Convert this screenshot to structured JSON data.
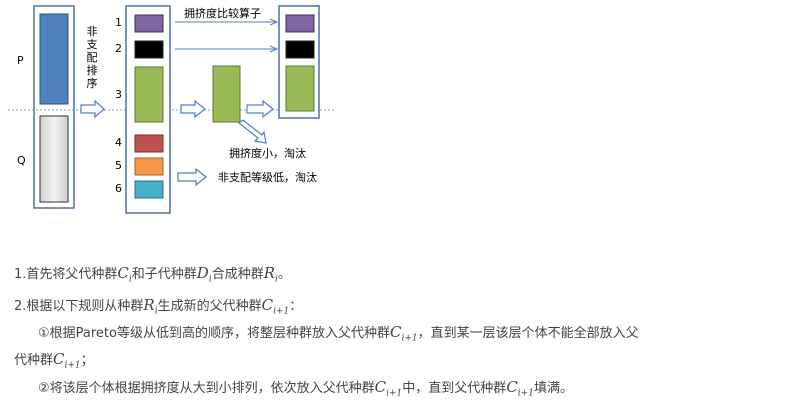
{
  "diagram": {
    "labels": {
      "P": "P",
      "Q": "Q"
    },
    "sort_text": "非支配排序",
    "crowding_operator": "拥挤度比较算子",
    "small_crowding": "拥挤度小，淘汰",
    "low_rank": "非支配等级低，淘汰",
    "ranks": [
      "1",
      "2",
      "3",
      "4",
      "5",
      "6"
    ],
    "colors": {
      "P": "#4f81bd",
      "Q": "#e0e0e0",
      "rank1": "#8064a2",
      "rank2": "#000000",
      "rank3": "#9bbb59",
      "rank4": "#c0504d",
      "rank5": "#f79646",
      "rank6": "#4bacc6",
      "box_border": "#4f6fa8",
      "arrow": "#4f81bd",
      "divider": "#7aa0d0"
    }
  },
  "text": {
    "line1": {
      "a": "1.首先将父代种群",
      "v1": "C",
      "s1": "i",
      "b": "和子代种群",
      "v2": "D",
      "s2": "i",
      "c": "合成种群",
      "v3": "R",
      "s3": "i",
      "d": "。"
    },
    "line2": {
      "a": "2.根据以下规则从种群",
      "v1": "R",
      "s1": "i",
      "b": "生成新的父代种群",
      "v2": "C",
      "s2": "i+1",
      "c": "："
    },
    "line3": {
      "a": "①根据Pareto等级从低到高的顺序，将整层种群放入父代种群",
      "v1": "C",
      "s1": "i+1",
      "b": "，直到某一层该层个体不能全部放入父"
    },
    "line4": {
      "a": "代种群",
      "v1": "C",
      "s1": "i+1",
      "b": "；"
    },
    "line5": {
      "a": "②将该层个体根据拥挤度从大到小排列，依次放入父代种群",
      "v1": "C",
      "s1": "i+1",
      "b": "中，直到父代种群",
      "v2": "C",
      "s2": "i+1",
      "c": "填满。"
    }
  }
}
